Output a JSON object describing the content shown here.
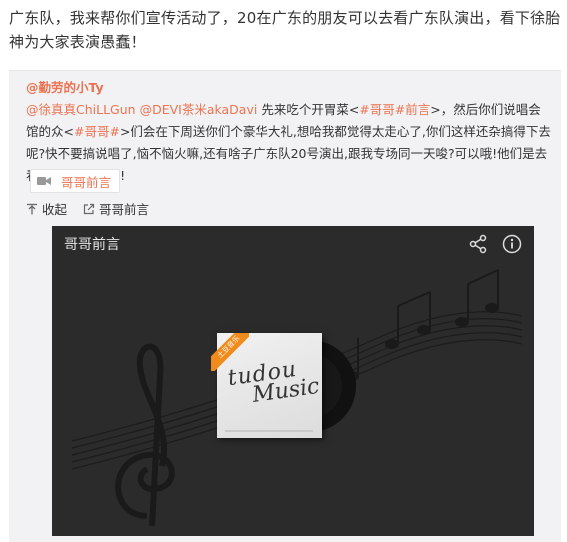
{
  "post": {
    "text": "广东队，我来帮你们宣传活动了，20在广东的朋友可以去看广东队演出，看下徐胎神为大家表演愚蠢！"
  },
  "repost": {
    "author": "@勤劳的小Ty",
    "mention1": "@徐真真ChiLLGun",
    "mention2": "@DEVI茶米akaDavi",
    "text_a": " 先来吃个开胃菜<",
    "topic1": "#哥哥#前言",
    "text_b": ">，然后你们说唱会馆的众<",
    "topic2": "#哥哥#",
    "text_c": ">们会在下周送你们个豪华大礼,想哈我都觉得太走心了,你们这样还杂搞得下去呢?快不要搞说唱了,恼不恼火嘛,还有啥子广东队20号演出,跟我专场同一天唆?可以哦!他们是去看胎神哇?胎神哇!",
    "video_chip_label": "哥哥前言",
    "actions": {
      "collapse": "收起",
      "source": "哥哥前言"
    }
  },
  "player": {
    "title": "哥哥前言",
    "cover_line1": "tudou",
    "cover_line2": "Music",
    "corner_tag": "土豆音乐",
    "icons": {
      "share": "share-icon",
      "info": "info-icon"
    }
  },
  "colors": {
    "link": "#eb7350",
    "repost_bg": "#f2f2f5",
    "player_bg": "#2b2b2b",
    "tag": "#f08a1a"
  }
}
